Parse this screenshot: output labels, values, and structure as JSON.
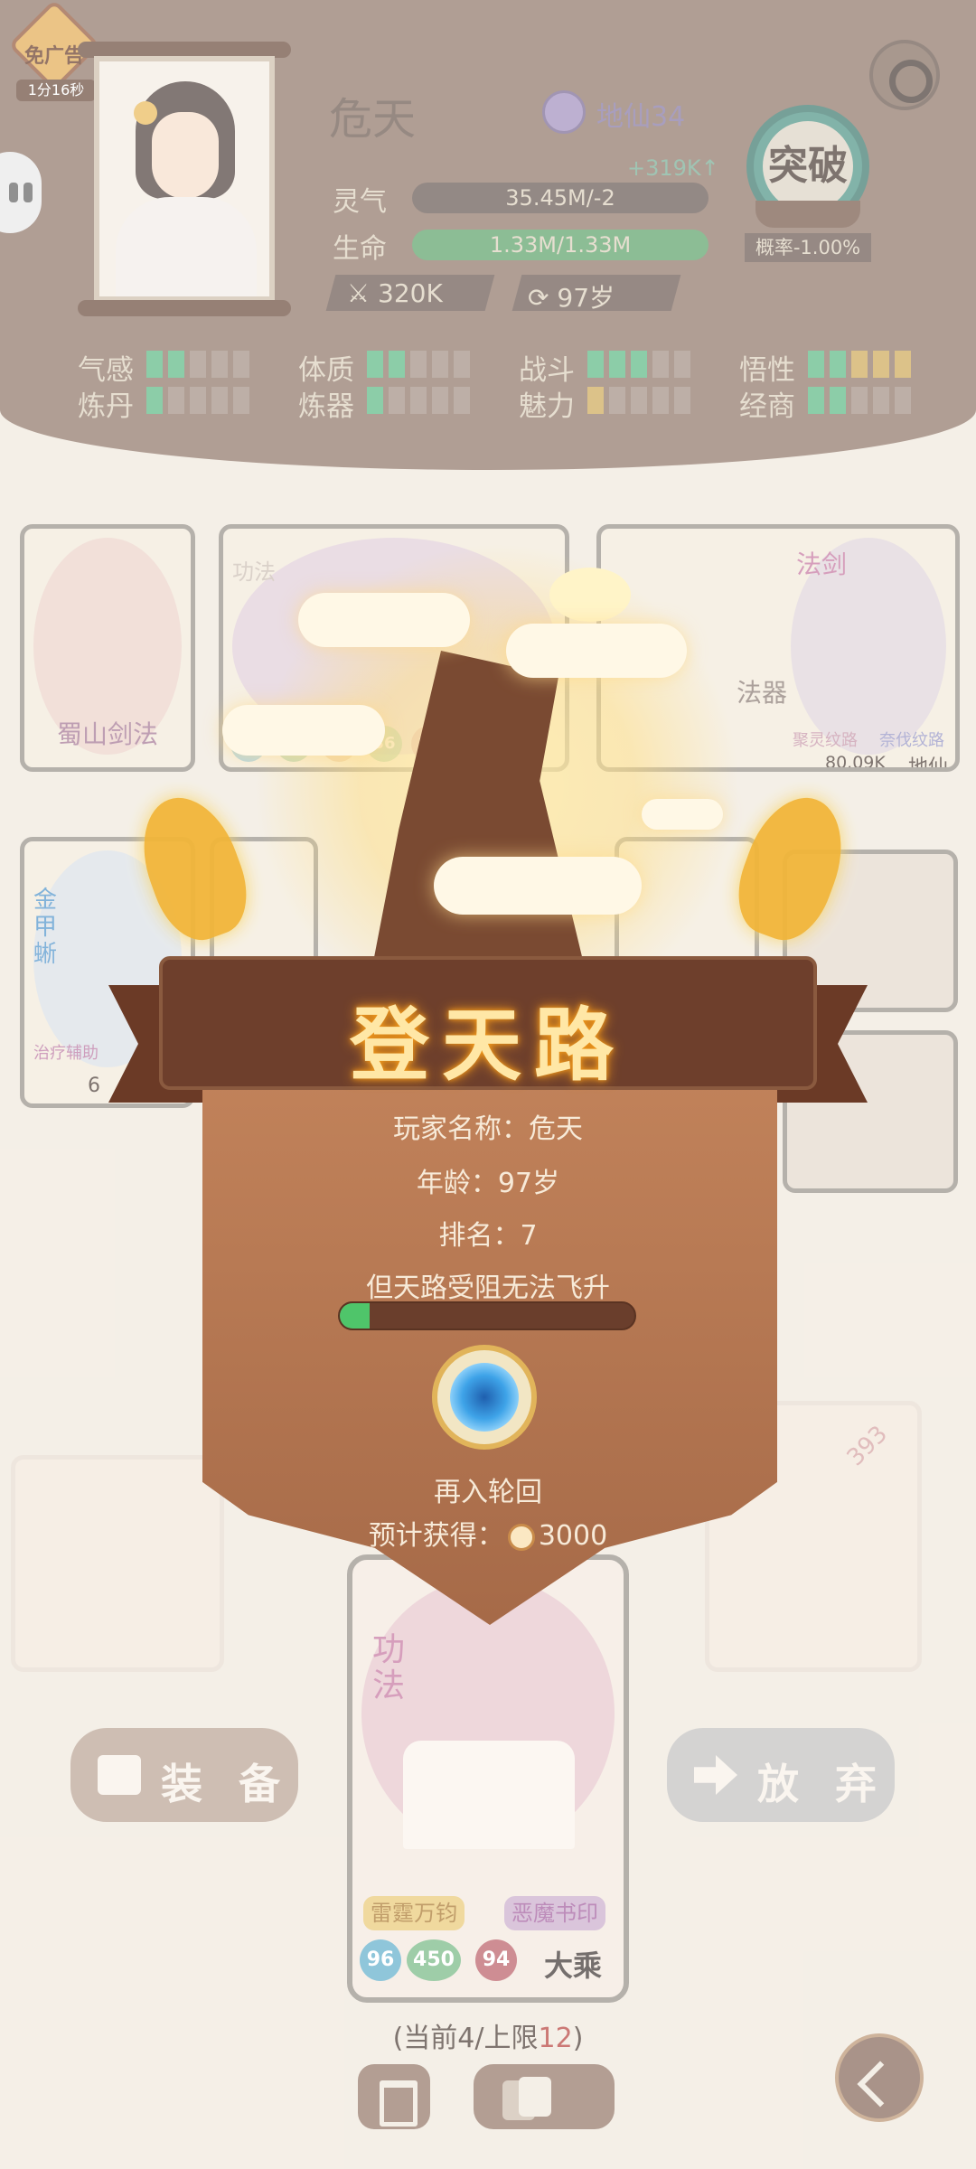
{
  "ad": {
    "label": "免广告",
    "timer": "1分16秒"
  },
  "player": {
    "name": "危天",
    "realm": "地仙34",
    "qi_gain": "+319K↑",
    "qi_label": "灵气",
    "qi_value": "35.45M/-2",
    "life_label": "生命",
    "life_value": "1.33M/1.33M",
    "life_fraction": 1.0,
    "power": "320K",
    "age": "97岁"
  },
  "breakthrough": {
    "label": "突破",
    "rate": "概率-1.00%"
  },
  "attributes": [
    {
      "name": "气感",
      "pips": [
        "g",
        "g",
        "x",
        "x",
        "x"
      ]
    },
    {
      "name": "体质",
      "pips": [
        "g",
        "g",
        "x",
        "x",
        "x"
      ]
    },
    {
      "name": "战斗",
      "pips": [
        "g",
        "g",
        "g",
        "x",
        "x"
      ]
    },
    {
      "name": "悟性",
      "pips": [
        "g",
        "g",
        "y",
        "y",
        "y"
      ]
    },
    {
      "name": "炼丹",
      "pips": [
        "g",
        "x",
        "x",
        "x",
        "x"
      ]
    },
    {
      "name": "炼器",
      "pips": [
        "g",
        "x",
        "x",
        "x",
        "x"
      ]
    },
    {
      "name": "魅力",
      "pips": [
        "y",
        "x",
        "x",
        "x",
        "x"
      ]
    },
    {
      "name": "经商",
      "pips": [
        "g",
        "g",
        "x",
        "x",
        "x"
      ]
    }
  ],
  "board": {
    "card_left": "蜀山剑法",
    "card_right_title": "法剑",
    "card_right_tags": [
      "聚灵纹路",
      "奈伐纹路"
    ],
    "card_right_power": "80.09K",
    "card_right_grade": "地仙",
    "card_pet_name": "金甲蜥",
    "card_pet_tag": "治疗辅助",
    "card_pet_power": "6",
    "mid_card_type": "功法",
    "mid_stats": [
      "74",
      "62",
      "34",
      "36",
      "88"
    ],
    "right_partial_label": "法器",
    "gem_count": "393"
  },
  "big_card": {
    "type": "功法",
    "tags": [
      "雷霆万钧",
      "恶魔书印"
    ],
    "stats": [
      "96",
      "450",
      "94"
    ],
    "grade": "大乘"
  },
  "actions": {
    "equip": "装 备",
    "discard": "放 弃"
  },
  "capacity": {
    "prefix": "(当前4/上限",
    "limit": "12",
    "suffix": ")"
  },
  "dialog": {
    "title": "登天路",
    "player_line": "玩家名称：危天",
    "age_line": "年龄：97岁",
    "rank_line": "排名：7",
    "note": "但天路受阻无法飞升",
    "progress_fraction": 0.1,
    "reborn_label": "再入轮回",
    "reward_prefix": "预计获得：",
    "reward_value": "3000"
  }
}
